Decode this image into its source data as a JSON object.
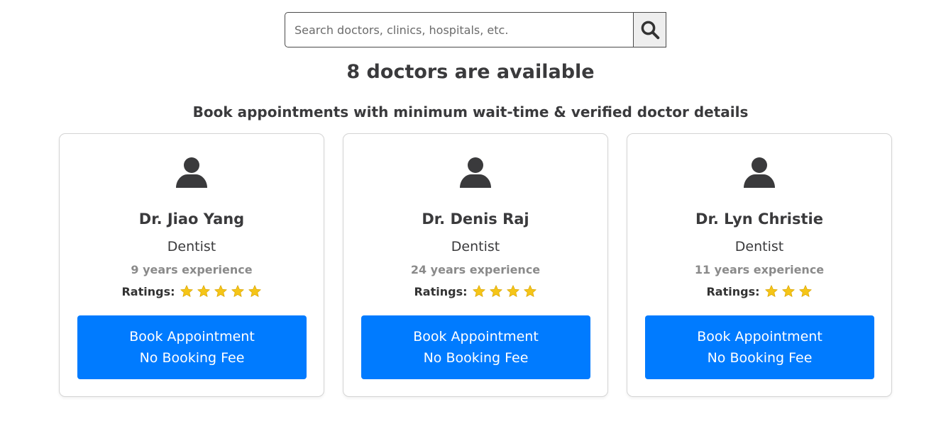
{
  "search": {
    "placeholder": "Search doctors, clinics, hospitals, etc.",
    "value": "",
    "button_icon": "search-icon"
  },
  "headings": {
    "count": "8 doctors are available",
    "subtitle": "Book appointments with minimum wait-time & verified doctor details"
  },
  "colors": {
    "primary_button": "#007bff",
    "star": "#f5c518",
    "text": "#3a3a3c",
    "muted": "#8a8a8a"
  },
  "doctors": [
    {
      "name": "Dr. Jiao Yang",
      "specialty": "Dentist",
      "experience": "9 years experience",
      "ratings_label": "Ratings:",
      "rating": 5,
      "button_line1": "Book Appointment",
      "button_line2": "No Booking Fee",
      "icon": "user-icon"
    },
    {
      "name": "Dr. Denis Raj",
      "specialty": "Dentist",
      "experience": "24 years experience",
      "ratings_label": "Ratings:",
      "rating": 4,
      "button_line1": "Book Appointment",
      "button_line2": "No Booking Fee",
      "icon": "user-icon"
    },
    {
      "name": "Dr. Lyn Christie",
      "specialty": "Dentist",
      "experience": "11 years experience",
      "ratings_label": "Ratings:",
      "rating": 3,
      "button_line1": "Book Appointment",
      "button_line2": "No Booking Fee",
      "icon": "user-icon"
    }
  ]
}
